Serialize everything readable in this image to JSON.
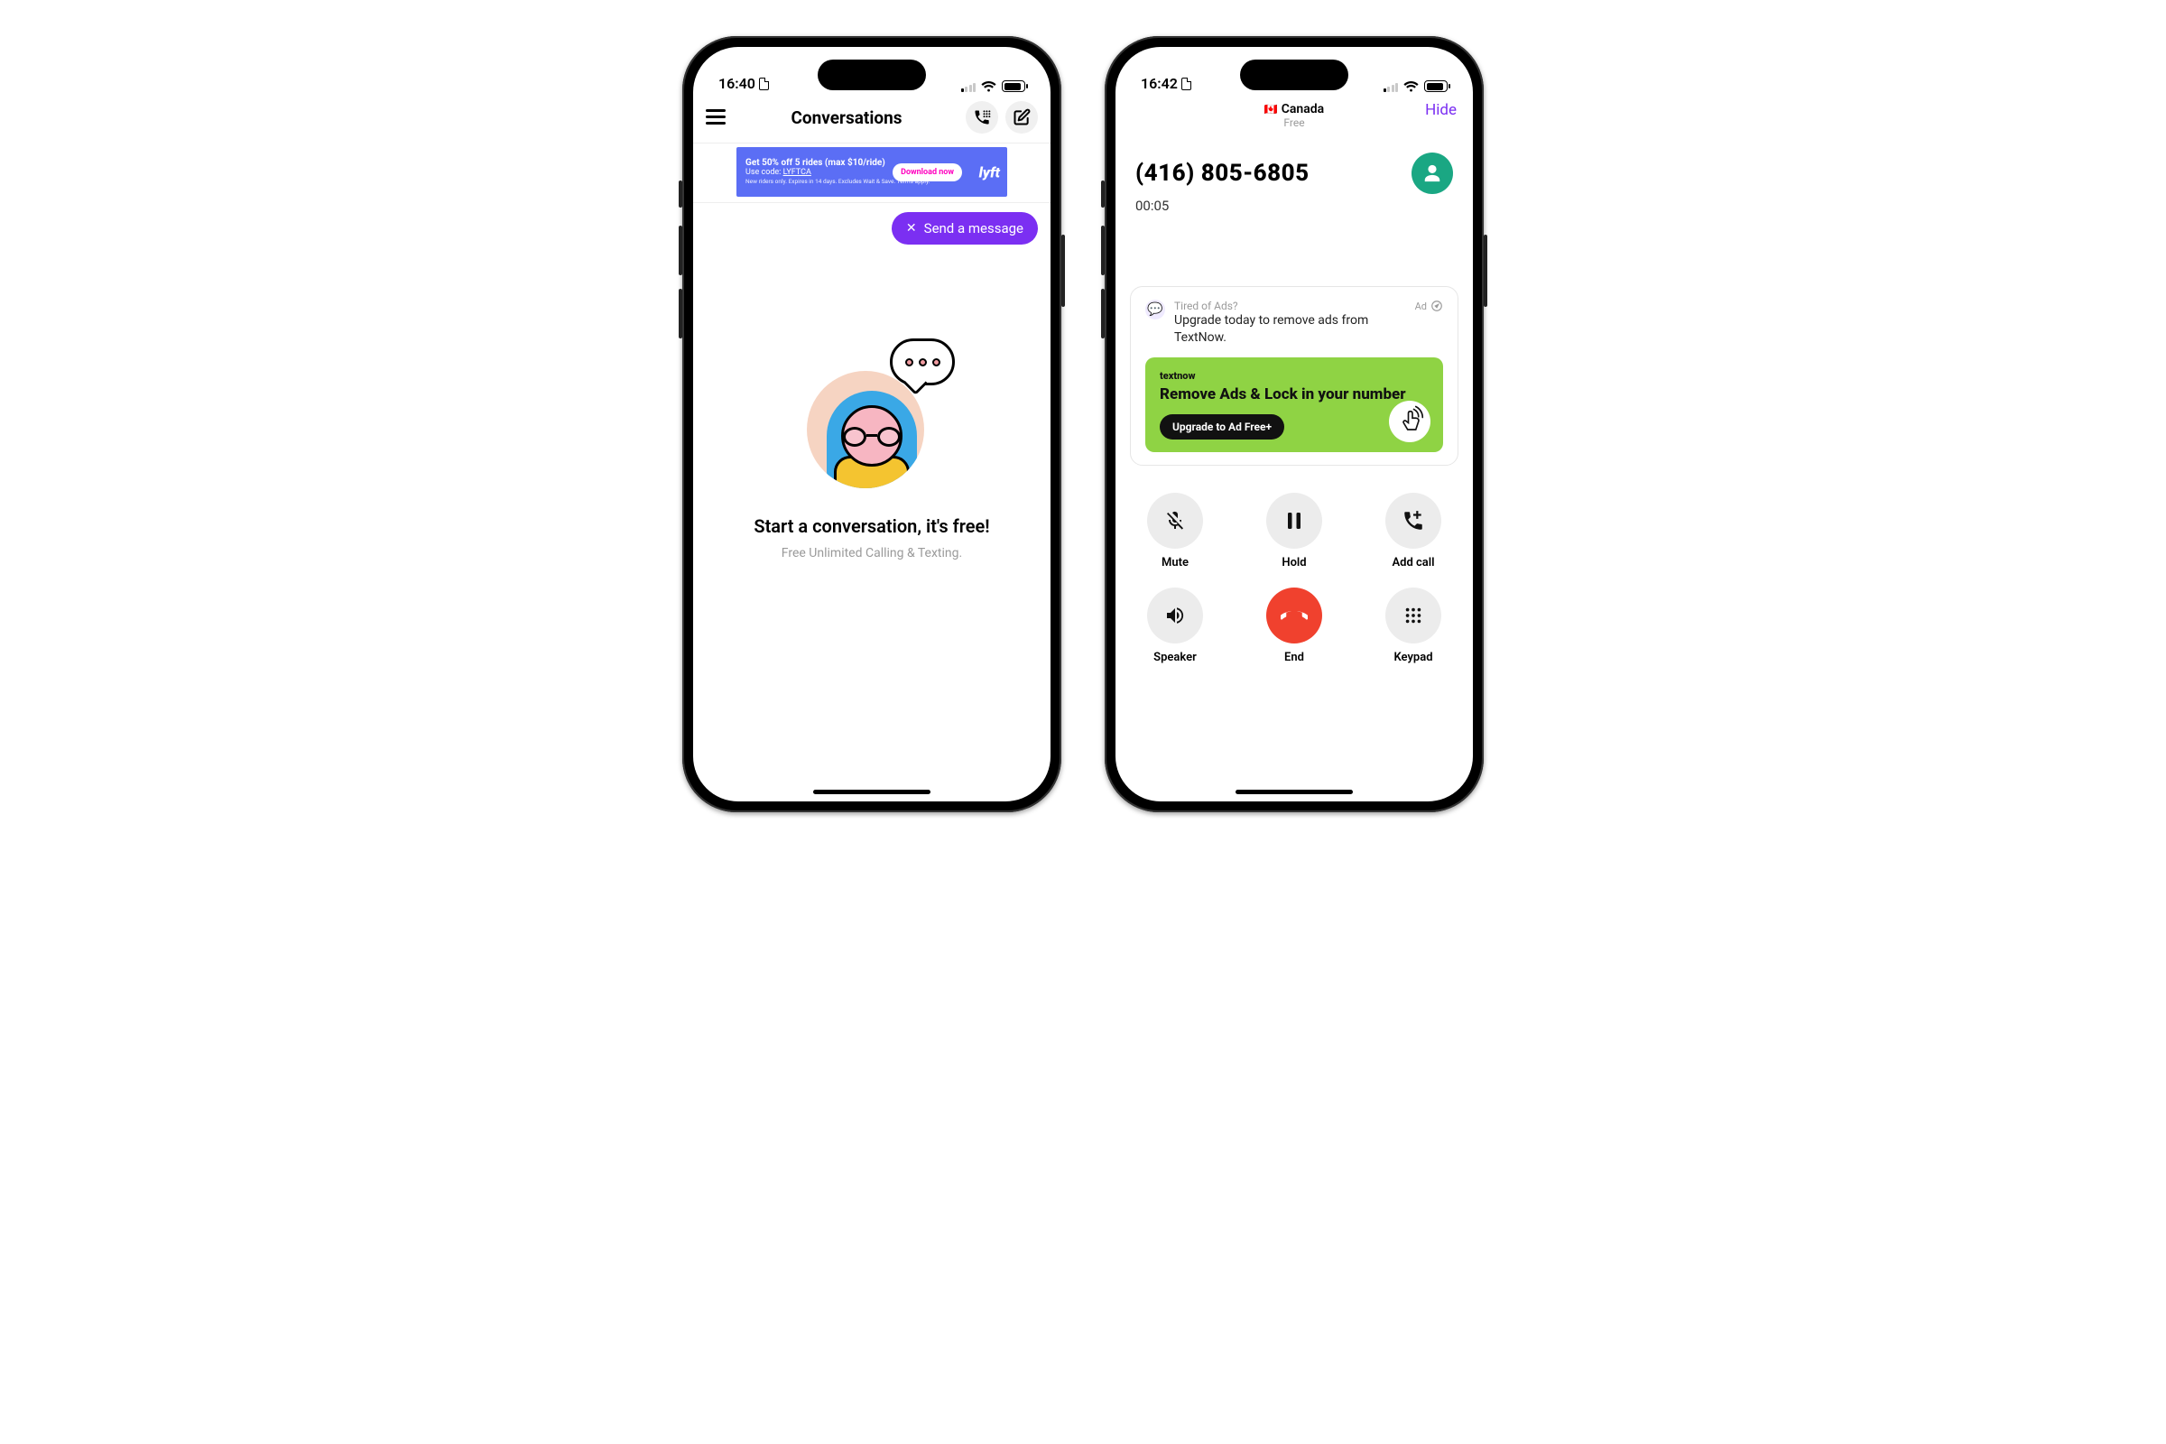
{
  "left": {
    "status": {
      "time": "16:40"
    },
    "nav": {
      "title": "Conversations"
    },
    "ad": {
      "title": "Get 50% off 5 rides (max $10/ride)",
      "code_label": "Use code:",
      "code": "LYFTCA",
      "fine": "New riders only. Expires in 14 days. Excludes Wait & Save. Terms apply.",
      "cta": "Download now",
      "brand": "lyft"
    },
    "send_message": "Send a message",
    "empty": {
      "title": "Start a conversation, it's free!",
      "subtitle": "Free Unlimited Calling & Texting."
    }
  },
  "right": {
    "status": {
      "time": "16:42"
    },
    "top": {
      "country": "Canada",
      "free": "Free",
      "hide": "Hide"
    },
    "call": {
      "number": "(416) 805-6805",
      "timer": "00:05"
    },
    "ad": {
      "tired": "Tired of Ads?",
      "msg": "Upgrade today to remove ads from TextNow.",
      "label": "Ad",
      "promo_brand": "textnow",
      "promo_head": "Remove Ads & Lock in your number",
      "promo_cta": "Upgrade to Ad Free+"
    },
    "buttons": {
      "mute": "Mute",
      "hold": "Hold",
      "addcall": "Add call",
      "speaker": "Speaker",
      "end": "End",
      "keypad": "Keypad"
    }
  }
}
